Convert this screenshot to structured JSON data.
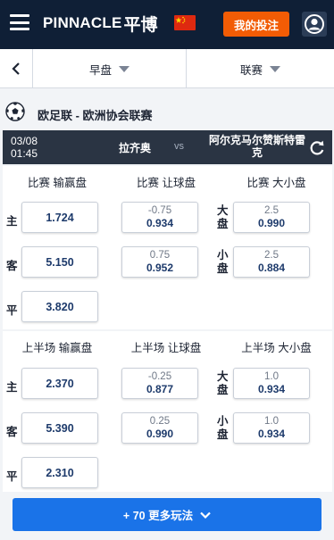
{
  "header": {
    "brand_latin": "PINNACLE",
    "brand_cjk": "平博",
    "my_bets_label": "我的投注",
    "accent_color": "#f25c05",
    "icons": [
      "menu-icon",
      "china-flag-icon",
      "user-icon"
    ]
  },
  "filters": {
    "period": "早盘",
    "sort": "联赛"
  },
  "league": {
    "name": "欧足联 - 欧洲协会联赛"
  },
  "event": {
    "date": "03/08",
    "time": "01:45",
    "home": "拉齐奥",
    "vs": "vs",
    "away": "阿尔克马尔赞斯特雷克"
  },
  "full_match": {
    "moneyline_header": "比赛 输赢盘",
    "handicap_header": "比赛 让球盘",
    "total_header": "比赛 大小盘",
    "moneyline": [
      {
        "label": "主",
        "price": "1.724"
      },
      {
        "label": "客",
        "price": "5.150"
      },
      {
        "label": "平",
        "price": "3.820"
      }
    ],
    "handicap": [
      {
        "line": "-0.75",
        "price": "0.934"
      },
      {
        "line": "0.75",
        "price": "0.952"
      }
    ],
    "totals": [
      {
        "label": "大盘",
        "line": "2.5",
        "price": "0.990"
      },
      {
        "label": "小盘",
        "line": "2.5",
        "price": "0.884"
      }
    ]
  },
  "first_half": {
    "moneyline_header": "上半场 输赢盘",
    "handicap_header": "上半场 让球盘",
    "total_header": "上半场 大小盘",
    "moneyline": [
      {
        "label": "主",
        "price": "2.370"
      },
      {
        "label": "客",
        "price": "5.390"
      },
      {
        "label": "平",
        "price": "2.310"
      }
    ],
    "handicap": [
      {
        "line": "-0.25",
        "price": "0.877"
      },
      {
        "line": "0.25",
        "price": "0.990"
      }
    ],
    "totals": [
      {
        "label": "大盘",
        "line": "1.0",
        "price": "0.934"
      },
      {
        "label": "小盘",
        "line": "1.0",
        "price": "0.934"
      }
    ]
  },
  "more_markets": {
    "label": "+ 70 更多玩法"
  }
}
